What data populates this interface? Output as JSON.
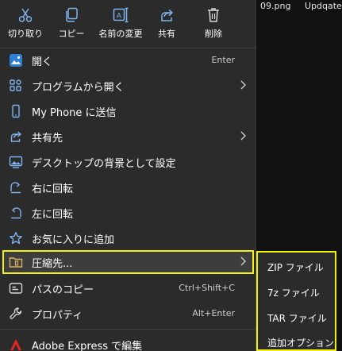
{
  "background": {
    "files": [
      "09.png",
      "Updqatec"
    ]
  },
  "quick_actions": [
    {
      "label": "切り取り",
      "icon": "scissors-icon"
    },
    {
      "label": "コピー",
      "icon": "copy-icon"
    },
    {
      "label": "名前の変更",
      "icon": "rename-icon"
    },
    {
      "label": "共有",
      "icon": "share-icon"
    },
    {
      "label": "削除",
      "icon": "trash-icon"
    }
  ],
  "menu_items": [
    {
      "label": "開く",
      "shortcut": "Enter",
      "icon": "photos-app-icon"
    },
    {
      "label": "プログラムから開く",
      "icon": "open-with-icon",
      "has_submenu": true
    },
    {
      "label": "My Phone に送信",
      "icon": "phone-icon"
    },
    {
      "label": "共有先",
      "icon": "share-icon",
      "has_submenu": true
    },
    {
      "label": "デスクトップの背景として設定",
      "icon": "wallpaper-icon"
    },
    {
      "label": "右に回転",
      "icon": "rotate-right-icon"
    },
    {
      "label": "左に回転",
      "icon": "rotate-left-icon"
    },
    {
      "label": "お気に入りに追加",
      "icon": "star-icon"
    },
    {
      "label": "圧縮先...",
      "icon": "archive-icon",
      "has_submenu": true,
      "highlighted": true
    },
    {
      "label": "パスのコピー",
      "shortcut": "Ctrl+Shift+C",
      "icon": "copy-path-icon"
    },
    {
      "label": "プロパティ",
      "shortcut": "Alt+Enter",
      "icon": "wrench-icon"
    },
    {
      "label": "Adobe Express で編集",
      "icon": "adobe-icon"
    }
  ],
  "compress_submenu": [
    {
      "label": "ZIP ファイル"
    },
    {
      "label": "7z ファイル"
    },
    {
      "label": "TAR ファイル"
    },
    {
      "label": "追加オプション"
    }
  ],
  "colors": {
    "menu_bg": "#2b2b2b",
    "highlight_border": "#f2f20e",
    "icon_blue": "#7fb4f0"
  }
}
